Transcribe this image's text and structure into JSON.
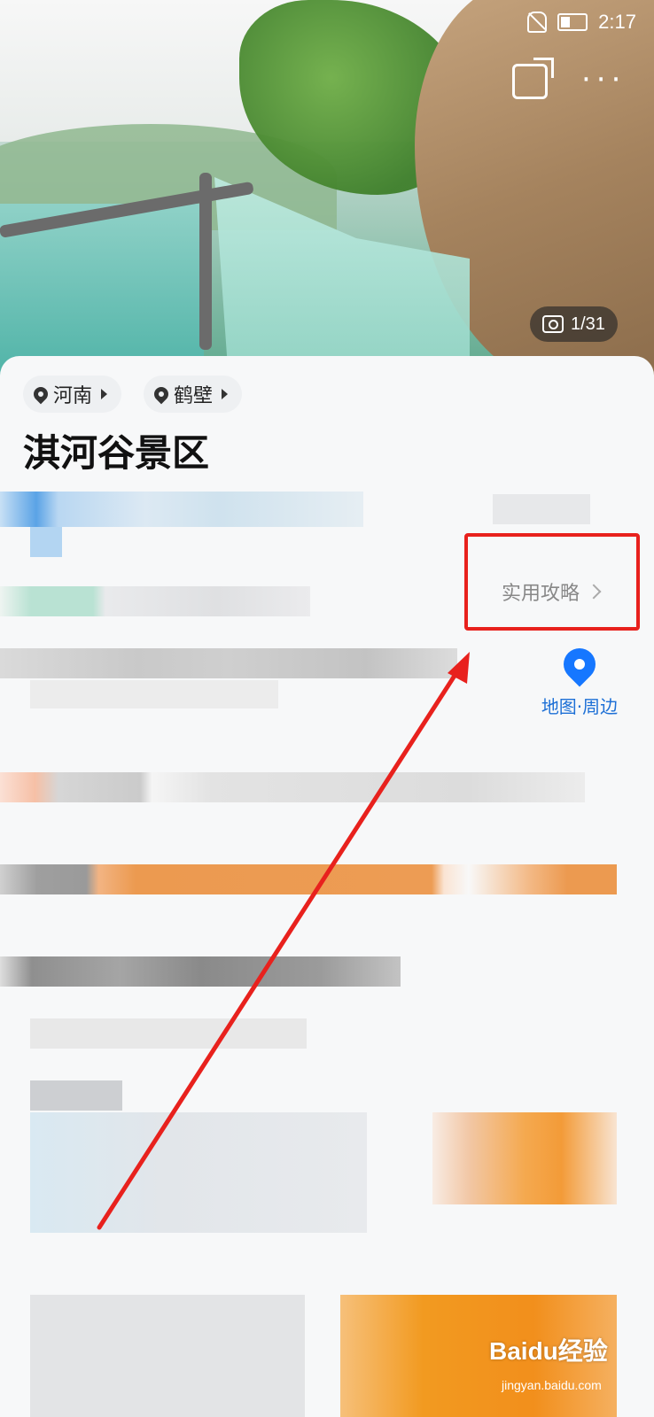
{
  "status_bar": {
    "time": "2:17"
  },
  "hero": {
    "photo_counter": "1/31"
  },
  "location_chips": [
    {
      "label": "河南"
    },
    {
      "label": "鹤壁"
    }
  ],
  "scenic_title": "淇河谷景区",
  "guide_link": {
    "label": "实用攻略"
  },
  "map_button": {
    "label": "地图·周边"
  },
  "watermark": {
    "brand": "Baidu经验",
    "domain": "jingyan.baidu.com"
  },
  "colors": {
    "highlight": "#e8211d",
    "accent": "#1677ff"
  }
}
